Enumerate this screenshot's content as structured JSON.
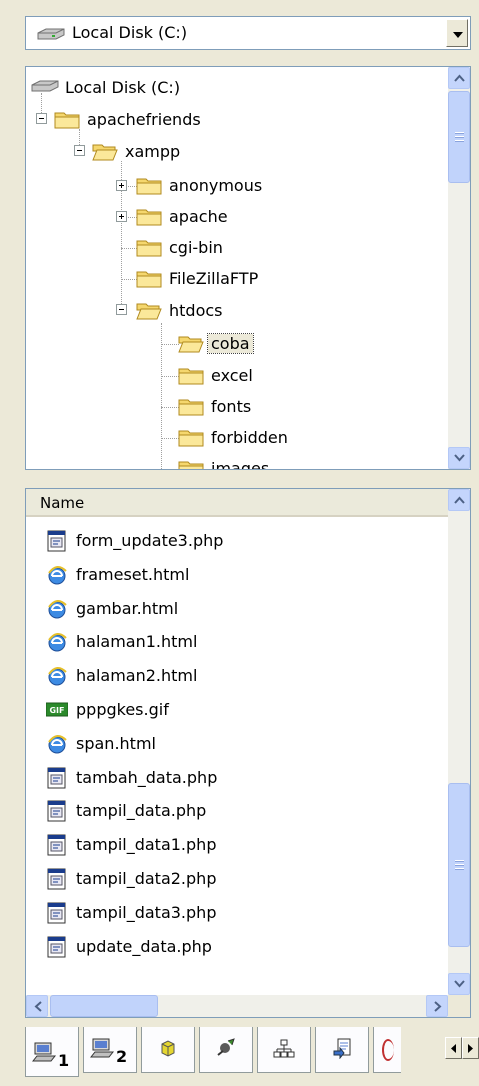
{
  "drive_selector": {
    "label": "Local Disk (C:)"
  },
  "tree": {
    "root": "Local Disk (C:)",
    "nodes": [
      {
        "label": "apachefriends"
      },
      {
        "label": "xampp"
      },
      {
        "label": "anonymous"
      },
      {
        "label": "apache"
      },
      {
        "label": "cgi-bin"
      },
      {
        "label": "FileZillaFTP"
      },
      {
        "label": "htdocs"
      },
      {
        "label": "coba"
      },
      {
        "label": "excel"
      },
      {
        "label": "fonts"
      },
      {
        "label": "forbidden"
      },
      {
        "label": "images"
      }
    ]
  },
  "file_list": {
    "column_name": "Name",
    "files": [
      {
        "name": "form_update3.php",
        "icon": "php-file-icon"
      },
      {
        "name": "frameset.html",
        "icon": "ie-html-icon"
      },
      {
        "name": "gambar.html",
        "icon": "ie-html-icon"
      },
      {
        "name": "halaman1.html",
        "icon": "ie-html-icon"
      },
      {
        "name": "halaman2.html",
        "icon": "ie-html-icon"
      },
      {
        "name": "pppgkes.gif",
        "icon": "gif-file-icon"
      },
      {
        "name": "span.html",
        "icon": "ie-html-icon"
      },
      {
        "name": "tambah_data.php",
        "icon": "php-file-icon"
      },
      {
        "name": "tampil_data.php",
        "icon": "php-file-icon"
      },
      {
        "name": "tampil_data1.php",
        "icon": "php-file-icon"
      },
      {
        "name": "tampil_data2.php",
        "icon": "php-file-icon"
      },
      {
        "name": "tampil_data3.php",
        "icon": "php-file-icon"
      },
      {
        "name": "update_data.php",
        "icon": "php-file-icon"
      }
    ]
  },
  "tabs": [
    {
      "num": "1",
      "icon": "computer-1-icon"
    },
    {
      "num": "2",
      "icon": "computer-2-icon"
    },
    {
      "num": "",
      "icon": "cube-icon"
    },
    {
      "num": "",
      "icon": "plugin-icon"
    },
    {
      "num": "",
      "icon": "network-icon"
    },
    {
      "num": "",
      "icon": "document-arrow-icon"
    }
  ],
  "colors": {
    "accent": "#316ac5",
    "folder": "#f5d76e",
    "scroll": "#c1d3fb"
  }
}
